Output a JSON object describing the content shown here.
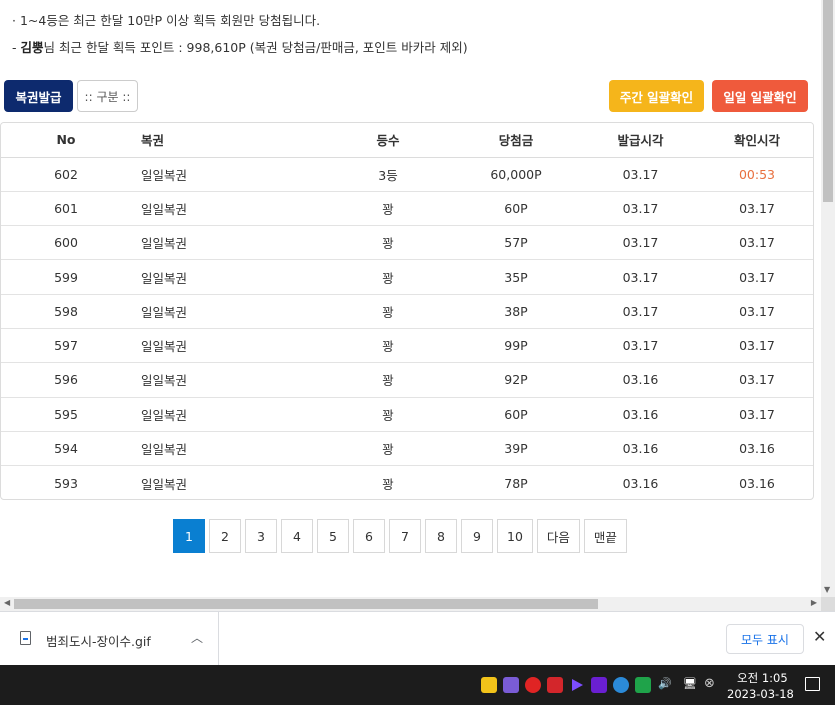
{
  "notices": {
    "line1": "· 1~4등은 최근 한달 10만P 이상 획득 회원만 당첨됩니다.",
    "line2_prefix": "- ",
    "line2_user": "김뿡",
    "line2_rest": "님 최근 한달 획득 포인트 : 998,610P (복권 당첨금/판매금, 포인트 바카라 제외)"
  },
  "toolbar": {
    "issue_label": "복권발급",
    "category_label": ":: 구분 ::",
    "weekly_label": "주간 일괄확인",
    "daily_label": "일일 일괄확인"
  },
  "table": {
    "headers": [
      "No",
      "복권",
      "등수",
      "당첨금",
      "발급시각",
      "확인시각"
    ],
    "rows": [
      {
        "no": "602",
        "name": "일일복권",
        "rank": "3등",
        "prize": "60,000P",
        "issued": "03.17",
        "checked": "00:53"
      },
      {
        "no": "601",
        "name": "일일복권",
        "rank": "꽝",
        "prize": "60P",
        "issued": "03.17",
        "checked": "03.17"
      },
      {
        "no": "600",
        "name": "일일복권",
        "rank": "꽝",
        "prize": "57P",
        "issued": "03.17",
        "checked": "03.17"
      },
      {
        "no": "599",
        "name": "일일복권",
        "rank": "꽝",
        "prize": "35P",
        "issued": "03.17",
        "checked": "03.17"
      },
      {
        "no": "598",
        "name": "일일복권",
        "rank": "꽝",
        "prize": "38P",
        "issued": "03.17",
        "checked": "03.17"
      },
      {
        "no": "597",
        "name": "일일복권",
        "rank": "꽝",
        "prize": "99P",
        "issued": "03.17",
        "checked": "03.17"
      },
      {
        "no": "596",
        "name": "일일복권",
        "rank": "꽝",
        "prize": "92P",
        "issued": "03.16",
        "checked": "03.17"
      },
      {
        "no": "595",
        "name": "일일복권",
        "rank": "꽝",
        "prize": "60P",
        "issued": "03.16",
        "checked": "03.17"
      },
      {
        "no": "594",
        "name": "일일복권",
        "rank": "꽝",
        "prize": "39P",
        "issued": "03.16",
        "checked": "03.16"
      },
      {
        "no": "593",
        "name": "일일복권",
        "rank": "꽝",
        "prize": "78P",
        "issued": "03.16",
        "checked": "03.16"
      }
    ]
  },
  "pagination": {
    "pages": [
      "1",
      "2",
      "3",
      "4",
      "5",
      "6",
      "7",
      "8",
      "9",
      "10"
    ],
    "current": "1",
    "next_label": "다음",
    "last_label": "맨끝"
  },
  "downloads": {
    "file_name": "범죄도시-장이수.gif",
    "show_all_label": "모두 표시"
  },
  "taskbar": {
    "time": "오전 1:05",
    "date": "2023-03-18"
  },
  "colors": {
    "issue_button": "#0d2a6e",
    "weekly_button": "#f5b51b",
    "daily_button": "#ef5a3c",
    "active_page": "#0a7fd1",
    "highlight_time": "#e8703f"
  }
}
